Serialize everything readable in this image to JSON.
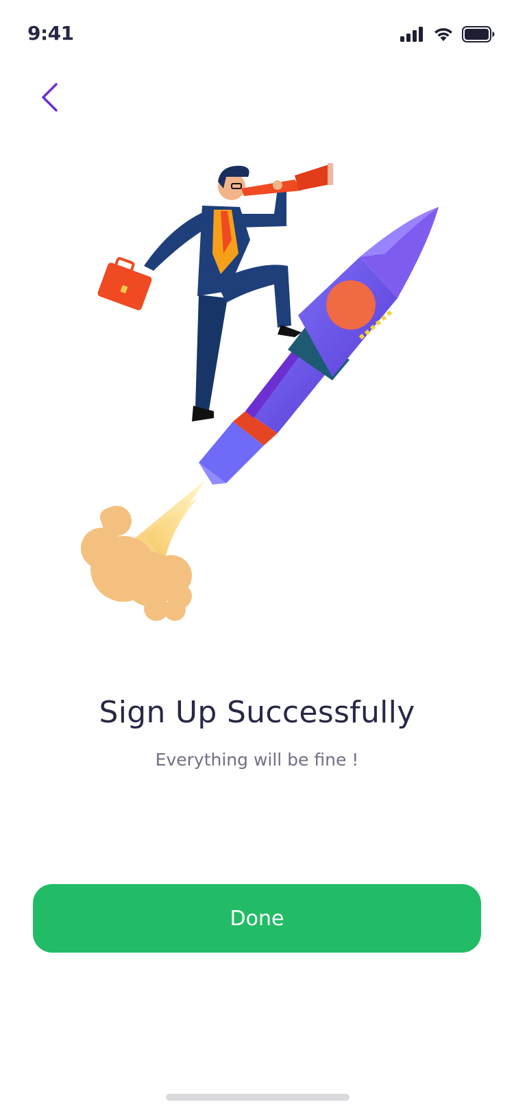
{
  "status_bar": {
    "time": "9:41",
    "icons": [
      "signal-icon",
      "wifi-icon",
      "battery-icon"
    ]
  },
  "navigation": {
    "back_icon": "chevron-left-icon",
    "accent_color": "#6a2bd8"
  },
  "content": {
    "illustration": "businessman-riding-rocket-illustration",
    "title": "Sign Up Successfully",
    "subtitle": "Everything will be fine !"
  },
  "actions": {
    "done_label": "Done",
    "done_color": "#22bc66"
  }
}
